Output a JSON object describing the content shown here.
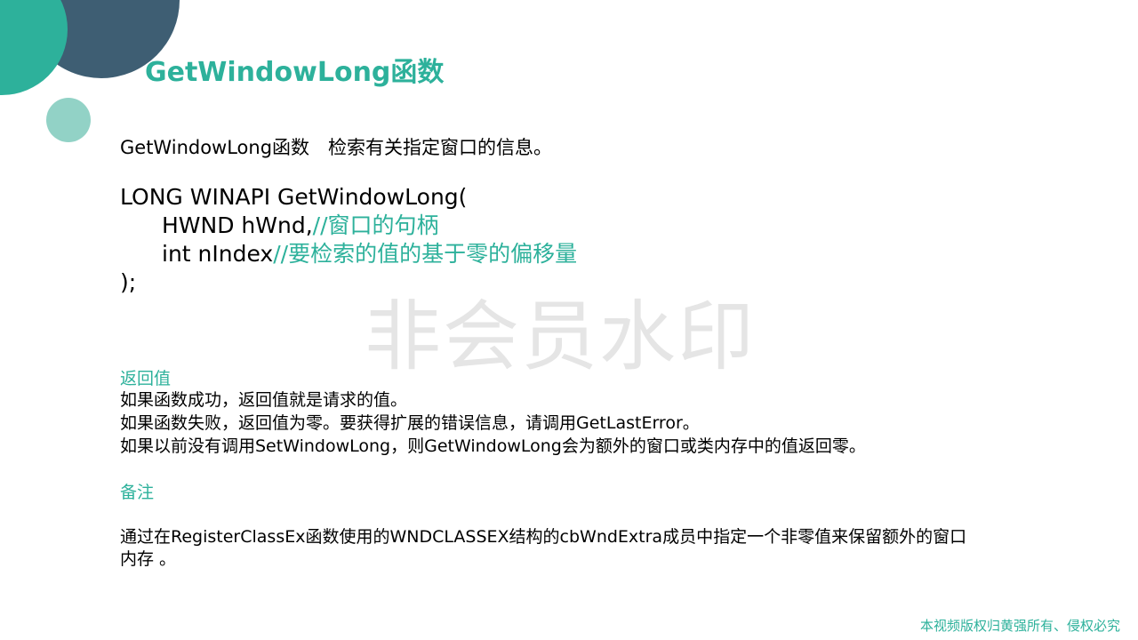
{
  "title": "GetWindowLong函数",
  "intro": "GetWindowLong函数　检索有关指定窗口的信息。",
  "code": {
    "line1": "LONG WINAPI GetWindowLong(",
    "param1": "HWND hWnd,",
    "param1_comment": "//窗口的句柄",
    "param2": "int  nIndex",
    "param2_comment": "//要检索的值的基于零的偏移量",
    "closing": ");"
  },
  "watermark": "非会员水印",
  "return_section": {
    "heading": "返回值",
    "lines": [
      "如果函数成功，返回值就是请求的值。",
      "如果函数失败，返回值为零。要获得扩展的错误信息，请调用GetLastError。",
      "如果以前没有调用SetWindowLong，则GetWindowLong会为额外的窗口或类内存中的值返回零。"
    ]
  },
  "notes_section": {
    "heading": "备注",
    "lines": [
      "通过在RegisterClassEx函数使用的WNDCLASSEX结构的cbWndExtra成员中指定一个非零值来保留额外的窗口",
      "内存 。"
    ]
  },
  "copyright": "本视频版权归黄强所有、侵权必究",
  "colors": {
    "accent": "#2db19b",
    "dark_circle": "#3e5e73",
    "light_circle": "#92d2c6"
  }
}
